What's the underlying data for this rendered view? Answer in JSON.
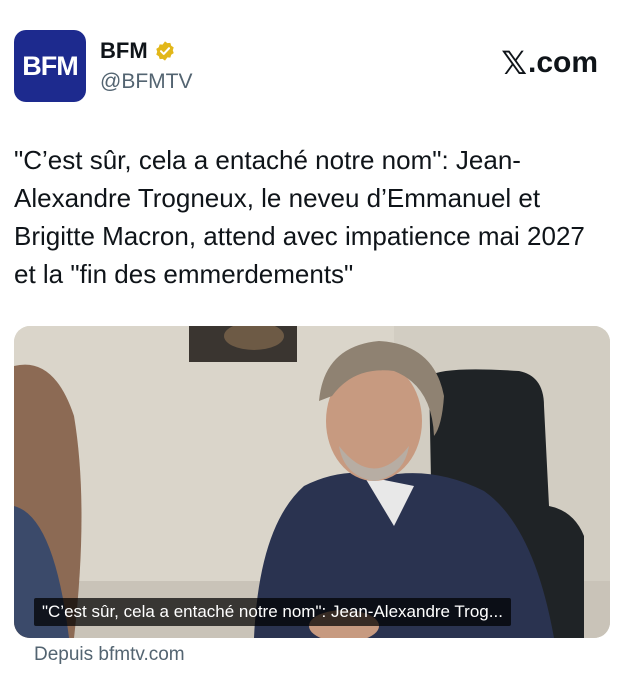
{
  "account": {
    "avatar_text": "BFM",
    "display_name": "BFM",
    "handle": "@BFMTV",
    "verified_badge_color": "#e2b719",
    "brand_color": "#1d2a8e"
  },
  "site_label": "com",
  "site_icon": "x-logo-icon",
  "tweet": {
    "text": "\"C’est sûr, cela a entaché notre nom\": Jean-Alexandre Trogneux, le neveu d’Emmanuel et Brigitte Macron, attend avec impatience mai 2027 et la \"fin des emmerdements\""
  },
  "media": {
    "caption": "\"C’est sûr, cela a entaché notre nom\": Jean-Alexandre Trog..."
  },
  "source_link": "Depuis bfmtv.com"
}
